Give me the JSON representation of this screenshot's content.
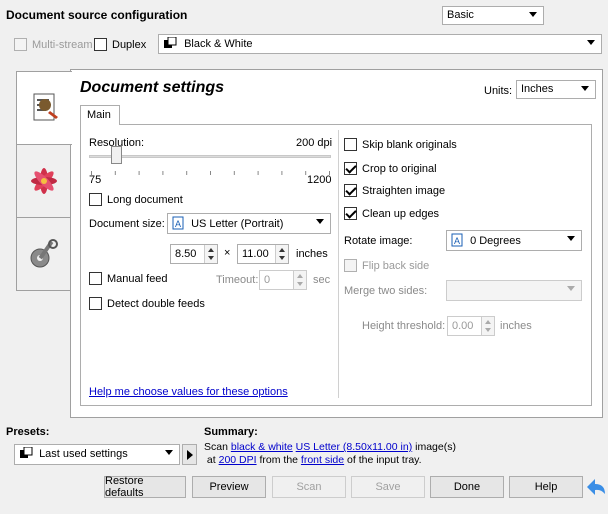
{
  "header": {
    "title": "Document source configuration",
    "mode_select": "Basic",
    "multistream_label": "Multi-stream",
    "duplex_label": "Duplex",
    "color_mode": "Black & White"
  },
  "panel": {
    "title": "Document settings",
    "units_label": "Units:",
    "units_value": "Inches",
    "tab_main": "Main"
  },
  "resolution": {
    "label": "Resolution:",
    "value_text": "200 dpi",
    "min": "75",
    "max": "1200",
    "level": 200
  },
  "left": {
    "long_document": "Long document",
    "doc_size_label": "Document size:",
    "doc_size_value": "US Letter (Portrait)",
    "width": "8.50",
    "times": "×",
    "height": "11.00",
    "inches": "inches",
    "manual_feed": "Manual feed",
    "timeout_label": "Timeout:",
    "timeout_value": "0",
    "sec": "sec",
    "detect_double": "Detect double feeds",
    "help_link": "Help me choose values for these options"
  },
  "right": {
    "skip_blank": "Skip blank originals",
    "crop": "Crop to original",
    "straighten": "Straighten image",
    "cleanup": "Clean up edges",
    "rotate_label": "Rotate image:",
    "rotate_value": "0 Degrees",
    "flip_back": "Flip back side",
    "merge_label": "Merge two sides:",
    "height_threshold_label": "Height threshold:",
    "height_threshold_value": "0.00",
    "height_unit": "inches"
  },
  "bottom": {
    "presets_label": "Presets:",
    "preset_value": "Last used settings",
    "summary_label": "Summary:",
    "summary_scan": "Scan",
    "summary_color": "black & white",
    "summary_size": "US Letter (8.50x11.00 in)",
    "summary_images": "image(s)",
    "summary_at": "at",
    "summary_dpi": "200 DPI",
    "summary_from": "from the",
    "summary_side": "front side",
    "summary_tail": "of the input tray."
  },
  "buttons": {
    "restore": "Restore defaults",
    "preview": "Preview",
    "scan": "Scan",
    "save": "Save",
    "done": "Done",
    "help": "Help"
  }
}
